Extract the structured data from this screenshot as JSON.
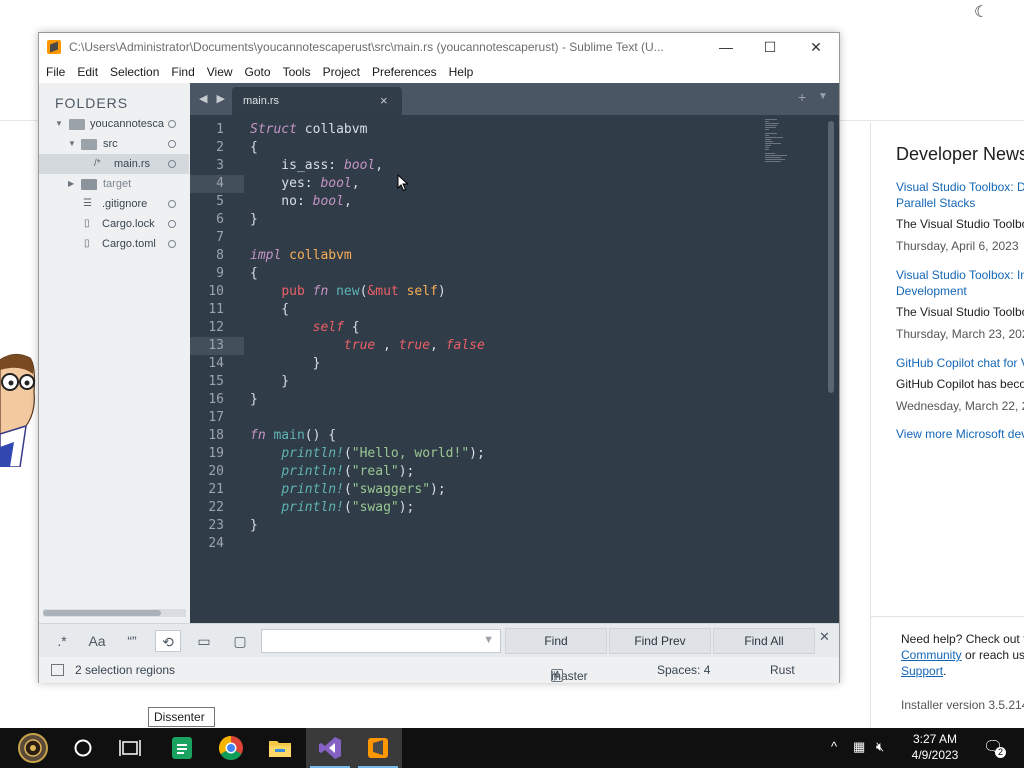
{
  "window": {
    "title": "C:\\Users\\Administrator\\Documents\\youcannotescaperust\\src\\main.rs (youcannotescaperust) - Sublime Text (U...",
    "minimize": "—",
    "maximize": "☐",
    "close": "✕"
  },
  "menu": [
    "File",
    "Edit",
    "Selection",
    "Find",
    "View",
    "Goto",
    "Tools",
    "Project",
    "Preferences",
    "Help"
  ],
  "sidebar": {
    "heading": "FOLDERS",
    "items": [
      {
        "label": "youcannotesca",
        "type": "folder-open"
      },
      {
        "label": "src",
        "type": "folder-open"
      },
      {
        "label": "main.rs",
        "type": "file-code"
      },
      {
        "label": "target",
        "type": "folder"
      },
      {
        "label": ".gitignore",
        "type": "file-text"
      },
      {
        "label": "Cargo.lock",
        "type": "file"
      },
      {
        "label": "Cargo.toml",
        "type": "file"
      }
    ]
  },
  "tabs": {
    "nav": "◀ ▶",
    "active": "main.rs",
    "close": "×",
    "plus": "+",
    "dropdown": "▼"
  },
  "editor": {
    "current_line": 13,
    "line_numbers": [
      "1",
      "2",
      "3",
      "4",
      "5",
      "6",
      "7",
      "8",
      "9",
      "10",
      "11",
      "12",
      "13",
      "14",
      "15",
      "16",
      "17",
      "18",
      "19",
      "20",
      "21",
      "22",
      "23",
      "24"
    ]
  },
  "find": {
    "regex": ".*",
    "case": "Aa",
    "whole_word": "“”",
    "wrap": "⟲",
    "in_selection": "▭",
    "highlight": "▢",
    "find_button": "Find",
    "find_prev_button": "Find Prev",
    "find_all_button": "Find All",
    "close": "✕",
    "dropdown": "▼",
    "value": ""
  },
  "status": {
    "selection": "2 selection regions",
    "branch": "master",
    "branch_count": "4",
    "spaces": "Spaces: 4",
    "syntax": "Rust"
  },
  "background": {
    "news_heading": "Developer News",
    "news": [
      {
        "title": "Visual Studio Toolbox: De\nParallel Stacks",
        "desc": "The Visual Studio Toolbo",
        "date": "Thursday, April 6, 2023"
      },
      {
        "title": "Visual Studio Toolbox: In\nDevelopment",
        "desc": "The Visual Studio Toolbo",
        "date": "Thursday, March 23, 202"
      },
      {
        "title": "GitHub Copilot chat for V",
        "desc": "GitHub Copilot has beco",
        "date": "Wednesday, March 22, 2"
      }
    ],
    "view_more": "View more Microsoft dev",
    "help_line1": "Need help? Check out t",
    "help_community": "Community",
    "help_line2": " or reach us",
    "help_support": "Support",
    "help_period": ".",
    "installer": "Installer version 3.5.214"
  },
  "tooltip": "Dissenter",
  "taskbar": {
    "time": "3:27 AM",
    "date": "4/9/2023",
    "notification_count": "2"
  }
}
